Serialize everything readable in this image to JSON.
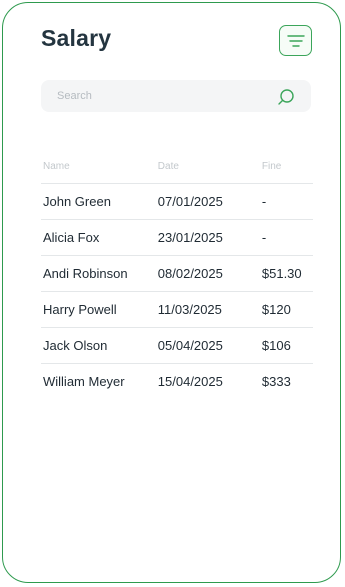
{
  "header": {
    "title": "Salary"
  },
  "search": {
    "placeholder": "Search"
  },
  "table": {
    "columns": [
      "Name",
      "Date",
      "Fine"
    ],
    "rows": [
      {
        "name": "John Green",
        "date": "07/01/2025",
        "fine": "-"
      },
      {
        "name": "Alicia Fox",
        "date": "23/01/2025",
        "fine": "-"
      },
      {
        "name": "Andi Robinson",
        "date": "08/02/2025",
        "fine": "$51.30"
      },
      {
        "name": "Harry Powell",
        "date": "11/03/2025",
        "fine": "$120"
      },
      {
        "name": "Jack Olson",
        "date": "05/04/2025",
        "fine": "$106"
      },
      {
        "name": "William Meyer",
        "date": "15/04/2025",
        "fine": "$333"
      }
    ]
  },
  "colors": {
    "accent": "#2e9a4e",
    "title": "#243540",
    "search_bg": "#f4f5f6",
    "header_text": "#c3c8cc"
  },
  "icons": {
    "filter": "filter-lines-icon",
    "search": "search-icon"
  }
}
